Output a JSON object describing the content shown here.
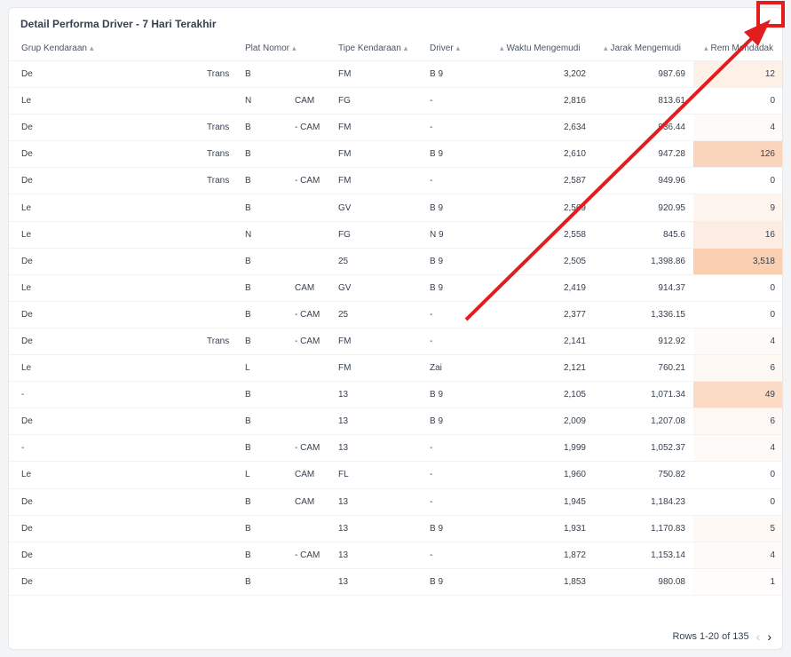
{
  "title": "Detail Performa Driver - 7 Hari Terakhir",
  "columns": {
    "grup": "Grup Kendaraan",
    "plat": "Plat Nomor",
    "tipe": "Tipe Kendaraan",
    "driver": "Driver",
    "waktu": "Waktu Mengemudi",
    "jarak": "Jarak Mengemudi",
    "rem": "Rem Mendadak"
  },
  "rows": [
    {
      "grup": "De",
      "grup2": "Trans",
      "plat": "B",
      "plat2": "",
      "tipe": "FM",
      "driver": "B 9",
      "waktu": "3,202",
      "jarak": "987.69",
      "rem": "12",
      "heat": 0.18
    },
    {
      "grup": "Le",
      "grup2": "",
      "plat": "N",
      "plat2": "CAM",
      "tipe": "FG",
      "driver": "-",
      "waktu": "2,816",
      "jarak": "813.61",
      "rem": "0",
      "heat": 0
    },
    {
      "grup": "De",
      "grup2": "Trans",
      "plat": "B",
      "plat2": "- CAM",
      "tipe": "FM",
      "driver": "-",
      "waktu": "2,634",
      "jarak": "936.44",
      "rem": "4",
      "heat": 0.06
    },
    {
      "grup": "De",
      "grup2": "Trans",
      "plat": "B",
      "plat2": "",
      "tipe": "FM",
      "driver": "B 9",
      "waktu": "2,610",
      "jarak": "947.28",
      "rem": "126",
      "heat": 0.5
    },
    {
      "grup": "De",
      "grup2": "Trans",
      "plat": "B",
      "plat2": "- CAM",
      "tipe": "FM",
      "driver": "-",
      "waktu": "2,587",
      "jarak": "949.96",
      "rem": "0",
      "heat": 0
    },
    {
      "grup": "Le",
      "grup2": "",
      "plat": "B",
      "plat2": "",
      "tipe": "GV",
      "driver": "B 9",
      "waktu": "2,569",
      "jarak": "920.95",
      "rem": "9",
      "heat": 0.12
    },
    {
      "grup": "Le",
      "grup2": "",
      "plat": "N",
      "plat2": "",
      "tipe": "FG",
      "driver": "N 9",
      "waktu": "2,558",
      "jarak": "845.6",
      "rem": "16",
      "heat": 0.22
    },
    {
      "grup": "De",
      "grup2": "",
      "plat": "B",
      "plat2": "",
      "tipe": "25",
      "driver": "B 9",
      "waktu": "2,505",
      "jarak": "1,398.86",
      "rem": "3,518",
      "heat": 0.58
    },
    {
      "grup": "Le",
      "grup2": "",
      "plat": "B",
      "plat2": "CAM",
      "tipe": "GV",
      "driver": "B 9",
      "waktu": "2,419",
      "jarak": "914.37",
      "rem": "0",
      "heat": 0
    },
    {
      "grup": "De",
      "grup2": "",
      "plat": "B",
      "plat2": "- CAM",
      "tipe": "25",
      "driver": "-",
      "waktu": "2,377",
      "jarak": "1,336.15",
      "rem": "0",
      "heat": 0
    },
    {
      "grup": "De",
      "grup2": "Trans",
      "plat": "B",
      "plat2": "- CAM",
      "tipe": "FM",
      "driver": "-",
      "waktu": "2,141",
      "jarak": "912.92",
      "rem": "4",
      "heat": 0.06
    },
    {
      "grup": "Le",
      "grup2": "",
      "plat": "L",
      "plat2": "",
      "tipe": "FM",
      "driver": "Zai",
      "waktu": "2,121",
      "jarak": "760.21",
      "rem": "6",
      "heat": 0.08
    },
    {
      "grup": "-",
      "grup2": "",
      "plat": "B",
      "plat2": "",
      "tipe": "13",
      "driver": "B 9",
      "waktu": "2,105",
      "jarak": "1,071.34",
      "rem": "49",
      "heat": 0.42
    },
    {
      "grup": "De",
      "grup2": "",
      "plat": "B",
      "plat2": "",
      "tipe": "13",
      "driver": "B 9",
      "waktu": "2,009",
      "jarak": "1,207.08",
      "rem": "6",
      "heat": 0.08
    },
    {
      "grup": "-",
      "grup2": "",
      "plat": "B",
      "plat2": "- CAM",
      "tipe": "13",
      "driver": "-",
      "waktu": "1,999",
      "jarak": "1,052.37",
      "rem": "4",
      "heat": 0.06
    },
    {
      "grup": "Le",
      "grup2": "",
      "plat": "L",
      "plat2": "CAM",
      "tipe": "FL",
      "driver": "-",
      "waktu": "1,960",
      "jarak": "750.82",
      "rem": "0",
      "heat": 0
    },
    {
      "grup": "De",
      "grup2": "",
      "plat": "B",
      "plat2": "CAM",
      "tipe": "13",
      "driver": "-",
      "waktu": "1,945",
      "jarak": "1,184.23",
      "rem": "0",
      "heat": 0
    },
    {
      "grup": "De",
      "grup2": "",
      "plat": "B",
      "plat2": "",
      "tipe": "13",
      "driver": "B 9",
      "waktu": "1,931",
      "jarak": "1,170.83",
      "rem": "5",
      "heat": 0.07
    },
    {
      "grup": "De",
      "grup2": "",
      "plat": "B",
      "plat2": "- CAM",
      "tipe": "13",
      "driver": "-",
      "waktu": "1,872",
      "jarak": "1,153.14",
      "rem": "4",
      "heat": 0.06
    },
    {
      "grup": "De",
      "grup2": "",
      "plat": "B",
      "plat2": "",
      "tipe": "13",
      "driver": "B 9",
      "waktu": "1,853",
      "jarak": "980.08",
      "rem": "1",
      "heat": 0.03
    }
  ],
  "pagination": {
    "label": "Rows 1-20 of 135",
    "prev_icon": "chevron-left-icon",
    "next_icon": "chevron-right-icon"
  },
  "colors": {
    "heat": "#f9c9a6",
    "annotation": "#e11d1d"
  }
}
